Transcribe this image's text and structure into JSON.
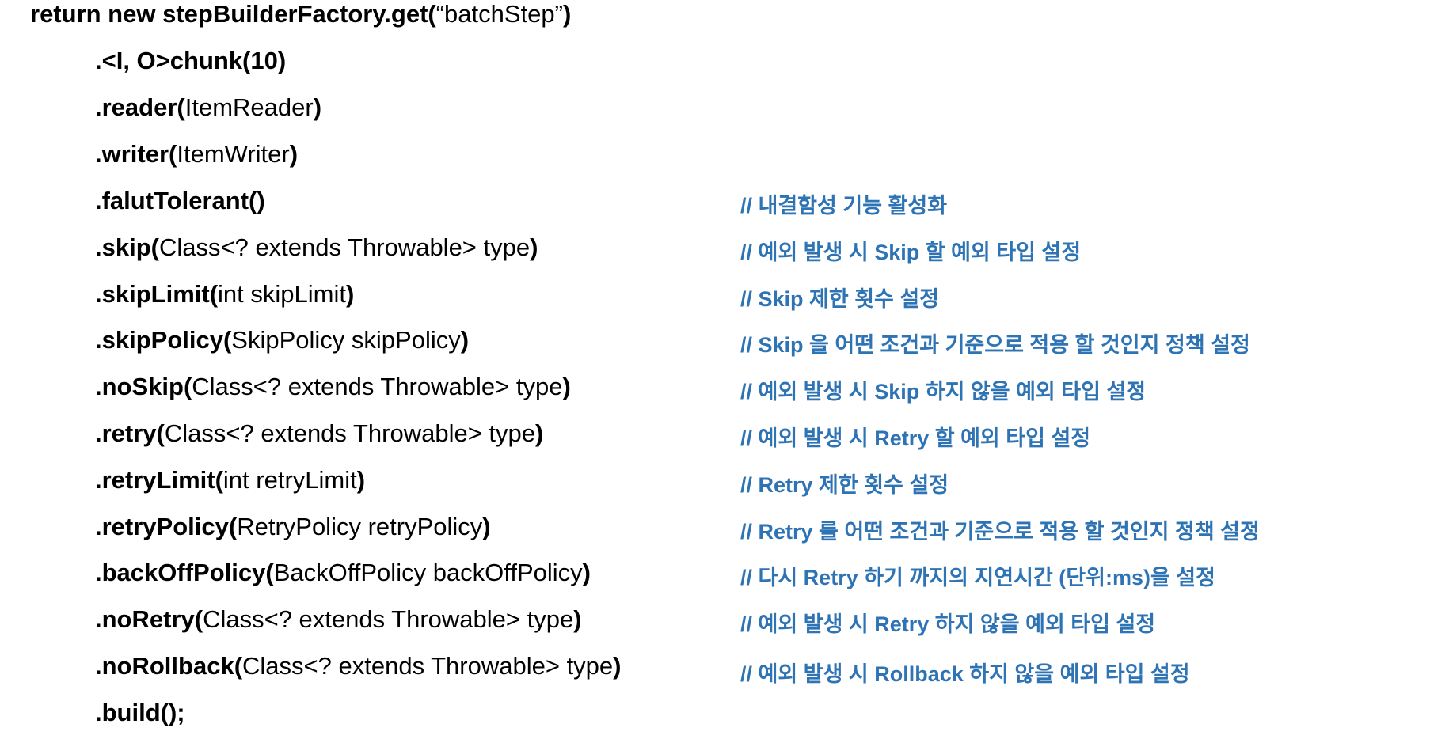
{
  "code": {
    "first": {
      "bold": "return new stepBuilderFactory.get(",
      "normal": "“batchStep”",
      "close": ")"
    },
    "lines": [
      {
        "method": ".<I, O>chunk(10)",
        "args": "",
        "close": ""
      },
      {
        "method": ".reader(",
        "args": "ItemReader",
        "close": ")"
      },
      {
        "method": ".writer(",
        "args": "ItemWriter",
        "close": ")"
      },
      {
        "method": ".falutTolerant()",
        "args": "",
        "close": ""
      },
      {
        "method": ".skip(",
        "args": "Class<? extends Throwable> type",
        "close": ")"
      },
      {
        "method": ".skipLimit(",
        "args": "int skipLimit",
        "close": ")"
      },
      {
        "method": ".skipPolicy(",
        "args": "SkipPolicy skipPolicy",
        "close": ")"
      },
      {
        "method": ".noSkip(",
        "args": "Class<? extends Throwable> type",
        "close": ")"
      },
      {
        "method": ".retry(",
        "args": "Class<? extends Throwable> type",
        "close": ")"
      },
      {
        "method": ".retryLimit(",
        "args": "int retryLimit",
        "close": ")"
      },
      {
        "method": ".retryPolicy(",
        "args": "RetryPolicy retryPolicy",
        "close": ")"
      },
      {
        "method": ".backOffPolicy(",
        "args": "BackOffPolicy backOffPolicy",
        "close": ")"
      },
      {
        "method": ".noRetry(",
        "args": "Class<? extends Throwable> type",
        "close": ")"
      },
      {
        "method": ".noRollback(",
        "args": "Class<? extends Throwable> type",
        "close": ")"
      },
      {
        "method": ".build();",
        "args": "",
        "close": ""
      }
    ]
  },
  "comments": [
    "// 내결함성 기능 활성화",
    "// 예외 발생 시 Skip 할 예외 타입 설정",
    "// Skip 제한 횟수 설정",
    "// Skip 을 어떤 조건과 기준으로 적용 할 것인지 정책 설정",
    "// 예외 발생 시 Skip 하지 않을 예외 타입 설정",
    "// 예외 발생 시 Retry 할 예외 타입 설정",
    "// Retry 제한 횟수 설정",
    "// Retry 를 어떤 조건과 기준으로 적용 할 것인지 정책 설정",
    "// 다시 Retry 하기 까지의 지연시간 (단위:ms)을 설정",
    "// 예외 발생 시 Retry 하지 않을 예외 타입 설정",
    "// 예외 발생 시 Rollback 하지 않을 예외 타입 설정"
  ],
  "colors": {
    "code": "#000000",
    "comment": "#2e74b5",
    "background": "#ffffff"
  }
}
